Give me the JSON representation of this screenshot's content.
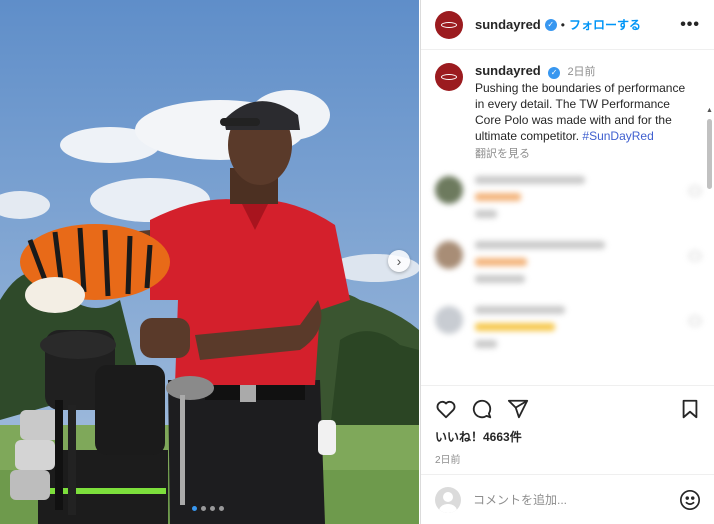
{
  "post": {
    "username": "sundayred",
    "follow_sep": "•",
    "follow_label": "フォローする",
    "more_label": "•••",
    "next_label": "›"
  },
  "caption": {
    "username": "sundayred",
    "time": "2日前",
    "text": "Pushing the boundaries of performance in every detail. The TW Performance Core Polo was made with and for the ultimate competitor. ",
    "hashtag": "#SunDayRed",
    "translate_label": "翻訳を見る"
  },
  "engagement": {
    "likes": "いいね！4663件",
    "posted": "2日前"
  },
  "comment_input": {
    "placeholder": "コメントを追加..."
  },
  "colors": {
    "brand": "#9b1b1f",
    "accent": "#0095f6",
    "verified": "#3897f0"
  },
  "carousel": {
    "count": 4,
    "active": 1
  }
}
